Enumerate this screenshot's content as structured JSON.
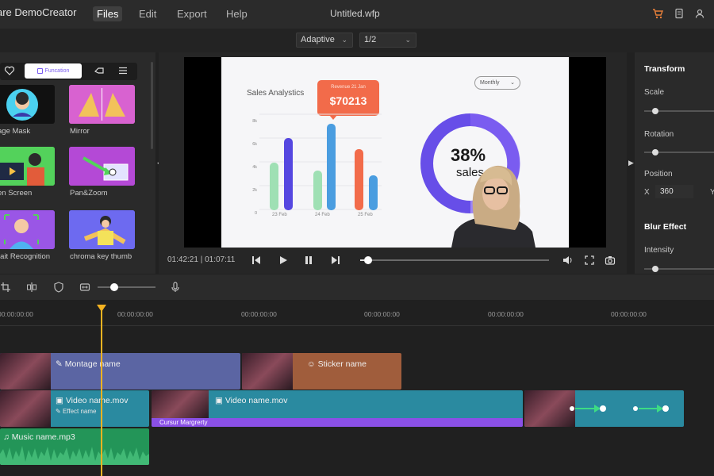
{
  "app": {
    "title": "are DemoCreator",
    "file_title": "Untitled.wfp"
  },
  "menu": [
    {
      "label": "Files",
      "active": true
    },
    {
      "label": "Edit",
      "active": false
    },
    {
      "label": "Export",
      "active": false
    },
    {
      "label": "Help",
      "active": false
    }
  ],
  "top_icons": [
    "cart-icon",
    "document-icon",
    "user-icon"
  ],
  "toolbar": {
    "quality": "Adaptive",
    "ratio": "1/2"
  },
  "left_panel": {
    "active_tab": "Funcation",
    "tab_icons": [
      "heart-icon",
      "function-icon",
      "hand-icon",
      "menu-icon"
    ],
    "items": [
      {
        "label": "age Mask"
      },
      {
        "label": "Mirror"
      },
      {
        "label": "en Screen"
      },
      {
        "label": "Pan&Zoom"
      },
      {
        "label": "rait Recognition"
      },
      {
        "label": "chroma key thumb"
      }
    ]
  },
  "preview": {
    "slide": {
      "title": "Sales Analystics",
      "badge_label": "Revenue 21 Jan",
      "badge_value": "$70213",
      "dropdown": "Monthly",
      "percent": "38%",
      "percent_label": "sales",
      "y_ticks": [
        "8k",
        "6k",
        "4k",
        "2k",
        "0"
      ],
      "x_labels": [
        "23 Feb",
        "24 Feb",
        "25 Feb"
      ]
    },
    "time_current": "01:42:21",
    "time_total": "01:07:11",
    "progress": 0.02
  },
  "right_panel": {
    "transform_heading": "Transform",
    "scale_label": "Scale",
    "rotation_label": "Rotation",
    "position_label": "Position",
    "x_label": "X",
    "x_value": "360",
    "y_label": "Y",
    "blur_heading": "Blur Effect",
    "intensity_label": "Intensity"
  },
  "timeline": {
    "ruler": [
      "00:00:00:00",
      "00:00:00:00",
      "00:00:00:00",
      "00:00:00:00",
      "00:00:00:00",
      "00:00:00:00"
    ],
    "clips": {
      "montage": "Montage name",
      "sticker": "Sticker name",
      "video1": "Video name.mov",
      "video1_effect": "Effect name",
      "video2": "Video name.mov",
      "video2_effect": "Cursur Margrerty",
      "music": "Music name.mp3"
    },
    "colors": {
      "montage": "#5b65a3",
      "sticker": "#a05d3c",
      "video": "#2a8aa0",
      "music": "#239558",
      "effect": "#8a50e6",
      "playhead": "#f5b321"
    }
  }
}
